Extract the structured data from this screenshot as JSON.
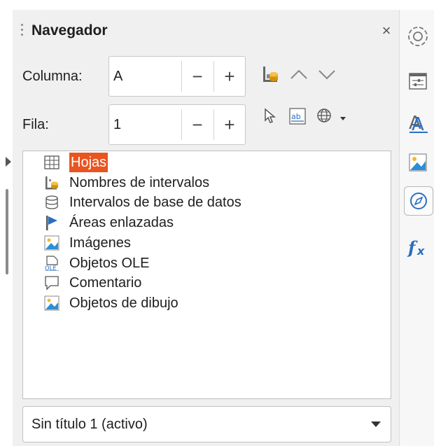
{
  "navigator": {
    "title": "Navegador",
    "close_glyph": "×",
    "column_label": "Columna:",
    "column_value": "A",
    "row_label": "Fila:",
    "row_value": "1",
    "minus": "−",
    "plus": "+"
  },
  "tree": {
    "items": [
      {
        "label": "Hojas",
        "icon": "sheets-table-icon",
        "selected": true
      },
      {
        "label": "Nombres de intervalos",
        "icon": "range-names-icon"
      },
      {
        "label": "Intervalos de base de datos",
        "icon": "database-icon"
      },
      {
        "label": "Áreas enlazadas",
        "icon": "linked-areas-flag-icon"
      },
      {
        "label": "Imágenes",
        "icon": "image-icon"
      },
      {
        "label": "Objetos OLE",
        "icon": "ole-object-icon"
      },
      {
        "label": "Comentario",
        "icon": "comment-icon"
      },
      {
        "label": "Objetos de dibujo",
        "icon": "drawing-objects-icon"
      }
    ]
  },
  "document_select": {
    "value": "Sin título 1 (activo)"
  },
  "toolbar_icons": [
    "data-range-icon",
    "chevron-up-icon",
    "chevron-down-icon",
    "drag-mode-icon",
    "display-mode-icon",
    "globe-icon"
  ],
  "sidebar_icons": [
    "gear-icon",
    "properties-icon",
    "styles-icon",
    "gallery-icon",
    "navigator-compass-icon",
    "functions-icon"
  ],
  "colors": {
    "selection": "#e95420",
    "sidebar_fx": "#2a6fbf"
  }
}
